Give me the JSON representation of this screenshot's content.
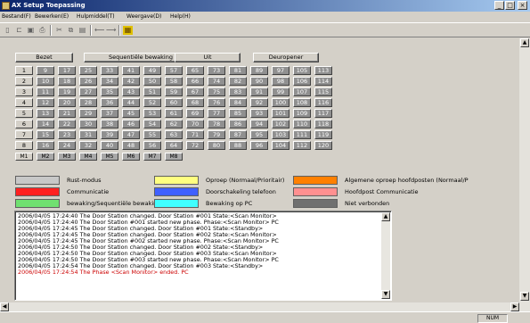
{
  "window": {
    "title": "AX Setup Toepassing",
    "controls": [
      "_",
      "□",
      "×"
    ]
  },
  "menu": [
    {
      "label": "Bestand(F)"
    },
    {
      "label": "Bewerken(E)"
    },
    {
      "label": "Hulpmiddel(T)"
    },
    {
      "label": "Weergave(D)"
    },
    {
      "label": "Help(H)"
    }
  ],
  "toolbar": {
    "icons": [
      "new-icon",
      "open-icon",
      "save-icon",
      "print-icon",
      "cut-icon",
      "copy-icon",
      "paste-icon",
      "connect-icon",
      "disconnect-icon",
      "highlight-icon"
    ]
  },
  "actions": {
    "bezet": "Bezet",
    "sequential": "Sequentiële bewaking",
    "uit": "Uit",
    "deuropener": "Deuropener"
  },
  "grid": {
    "rows": [
      {
        "label": "1",
        "stations": [
          "9",
          "17",
          "25",
          "33",
          "41",
          "49",
          "57",
          "65",
          "73",
          "81",
          "89",
          "97",
          "105",
          "113"
        ]
      },
      {
        "label": "2",
        "stations": [
          "10",
          "18",
          "26",
          "34",
          "42",
          "50",
          "58",
          "66",
          "74",
          "82",
          "90",
          "98",
          "106",
          "114"
        ]
      },
      {
        "label": "3",
        "stations": [
          "11",
          "19",
          "27",
          "35",
          "43",
          "51",
          "59",
          "67",
          "75",
          "83",
          "91",
          "99",
          "107",
          "115"
        ]
      },
      {
        "label": "4",
        "stations": [
          "12",
          "20",
          "28",
          "36",
          "44",
          "52",
          "60",
          "68",
          "76",
          "84",
          "92",
          "100",
          "108",
          "116"
        ]
      },
      {
        "label": "5",
        "stations": [
          "13",
          "21",
          "29",
          "37",
          "45",
          "53",
          "61",
          "69",
          "77",
          "85",
          "93",
          "101",
          "109",
          "117"
        ]
      },
      {
        "label": "6",
        "stations": [
          "14",
          "22",
          "30",
          "38",
          "46",
          "54",
          "62",
          "70",
          "78",
          "86",
          "94",
          "102",
          "110",
          "118"
        ]
      },
      {
        "label": "7",
        "stations": [
          "15",
          "23",
          "31",
          "39",
          "47",
          "55",
          "63",
          "71",
          "79",
          "87",
          "95",
          "103",
          "111",
          "119"
        ]
      },
      {
        "label": "8",
        "stations": [
          "16",
          "24",
          "32",
          "40",
          "48",
          "56",
          "64",
          "72",
          "80",
          "88",
          "96",
          "104",
          "112",
          "120"
        ]
      }
    ],
    "m_buttons": [
      "M1",
      "M2",
      "M3",
      "M4",
      "M5",
      "M6",
      "M7",
      "M8"
    ]
  },
  "legend": [
    {
      "label": "Rust-modus",
      "color": "#c8c8c8"
    },
    {
      "label": "Oproep (Normaal/Prioritair)",
      "color": "#ffff80"
    },
    {
      "label": "Algemene oproep hoofdposten (Normaal/P",
      "color": "#ff8000"
    },
    {
      "label": "Communicatie",
      "color": "#ff2020"
    },
    {
      "label": "Doorschakeling telefoon",
      "color": "#4060ff"
    },
    {
      "label": "Hoofdpost Communicatie",
      "color": "#ff9090"
    },
    {
      "label": "bewaking/Sequentiële bewaking",
      "color": "#70e070"
    },
    {
      "label": "Bewaking op PC",
      "color": "#40ffff"
    },
    {
      "label": "Niet verbonden",
      "color": "#707070"
    }
  ],
  "log": [
    {
      "text": "2006/04/05 17:24:40 The Door Station changed. Door Station #001 State:<Scan Monitor>",
      "color": "#000000"
    },
    {
      "text": "2006/04/05 17:24:40 The Door Station #001 started new phase. Phase:<Scan Monitor> PC",
      "color": "#000000"
    },
    {
      "text": "2006/04/05 17:24:45 The Door Station changed. Door Station #001 State:<Standby>",
      "color": "#000000"
    },
    {
      "text": "2006/04/05 17:24:45 The Door Station changed. Door Station #002 State:<Scan Monitor>",
      "color": "#000000"
    },
    {
      "text": "2006/04/05 17:24:45 The Door Station #002 started new phase. Phase:<Scan Monitor> PC",
      "color": "#000000"
    },
    {
      "text": "2006/04/05 17:24:50 The Door Station changed. Door Station #002 State:<Standby>",
      "color": "#000000"
    },
    {
      "text": "2006/04/05 17:24:50 The Door Station changed. Door Station #003 State:<Scan Monitor>",
      "color": "#000000"
    },
    {
      "text": "2006/04/05 17:24:50 The Door Station #003 started new phase. Phase:<Scan Monitor> PC",
      "color": "#000000"
    },
    {
      "text": "2006/04/05 17:24:54 The Door Station changed. Door Station #003 State:<Standby>",
      "color": "#000000"
    },
    {
      "text": "2006/04/05 17:24:54 The Phase <Scan Monitor> ended. PC",
      "color": "#cc0000"
    }
  ],
  "status": {
    "num": "NUM"
  }
}
